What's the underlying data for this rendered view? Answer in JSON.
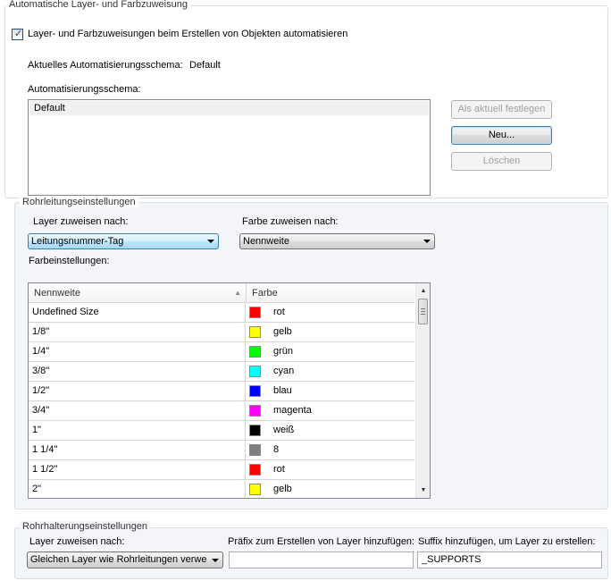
{
  "auto_group": {
    "title": "Automatische Layer- und Farbzuweisung",
    "checkbox_label": "Layer- und Farbzuweisungen beim Erstellen von Objekten automatisieren",
    "checkbox_checked": true,
    "current_scheme_label": "Aktuelles Automatisierungsschema:",
    "current_scheme_value": "Default",
    "scheme_list_label": "Automatisierungsschema:",
    "scheme_items": [
      "Default"
    ],
    "buttons": {
      "set_current": "Als aktuell festlegen",
      "new": "Neu...",
      "delete": "Löschen"
    }
  },
  "pipe_group": {
    "title": "Rohrleitungseinstellungen",
    "layer_label": "Layer zuweisen nach:",
    "layer_value": "Leitungsnummer-Tag",
    "color_label": "Farbe zuweisen nach:",
    "color_value": "Nennweite",
    "color_settings_label": "Farbeinstellungen:",
    "grid": {
      "columns": [
        "Nennweite",
        "Farbe"
      ],
      "rows": [
        {
          "size": "Undefined Size",
          "color_name": "rot",
          "color": "#ff0000"
        },
        {
          "size": "1/8\"",
          "color_name": "gelb",
          "color": "#ffff00"
        },
        {
          "size": "1/4\"",
          "color_name": "grün",
          "color": "#00ff00"
        },
        {
          "size": "3/8\"",
          "color_name": "cyan",
          "color": "#00ffff"
        },
        {
          "size": "1/2\"",
          "color_name": "blau",
          "color": "#0000ff"
        },
        {
          "size": "3/4\"",
          "color_name": "magenta",
          "color": "#ff00ff"
        },
        {
          "size": "1\"",
          "color_name": "weiß",
          "color": "#000000"
        },
        {
          "size": "1 1/4\"",
          "color_name": "8",
          "color": "#808080"
        },
        {
          "size": "1 1/2\"",
          "color_name": "rot",
          "color": "#ff0000"
        },
        {
          "size": "2\"",
          "color_name": "gelb",
          "color": "#ffff00"
        }
      ]
    }
  },
  "support_group": {
    "title": "Rohrhalterungseinstellungen",
    "layer_label": "Layer zuweisen nach:",
    "layer_value": "Gleichen Layer wie Rohrleitungen verwenden",
    "prefix_label": "Präfix zum Erstellen von Layer hinzufügen:",
    "prefix_value": "",
    "suffix_label": "Suffix hinzufügen, um Layer zu erstellen:",
    "suffix_value": "_SUPPORTS"
  },
  "icons": {
    "sort_indicator": "sort-up-icon",
    "scroll_up": "arrow-up-icon",
    "scroll_down": "arrow-down-icon",
    "dropdown": "chevron-down-icon"
  }
}
